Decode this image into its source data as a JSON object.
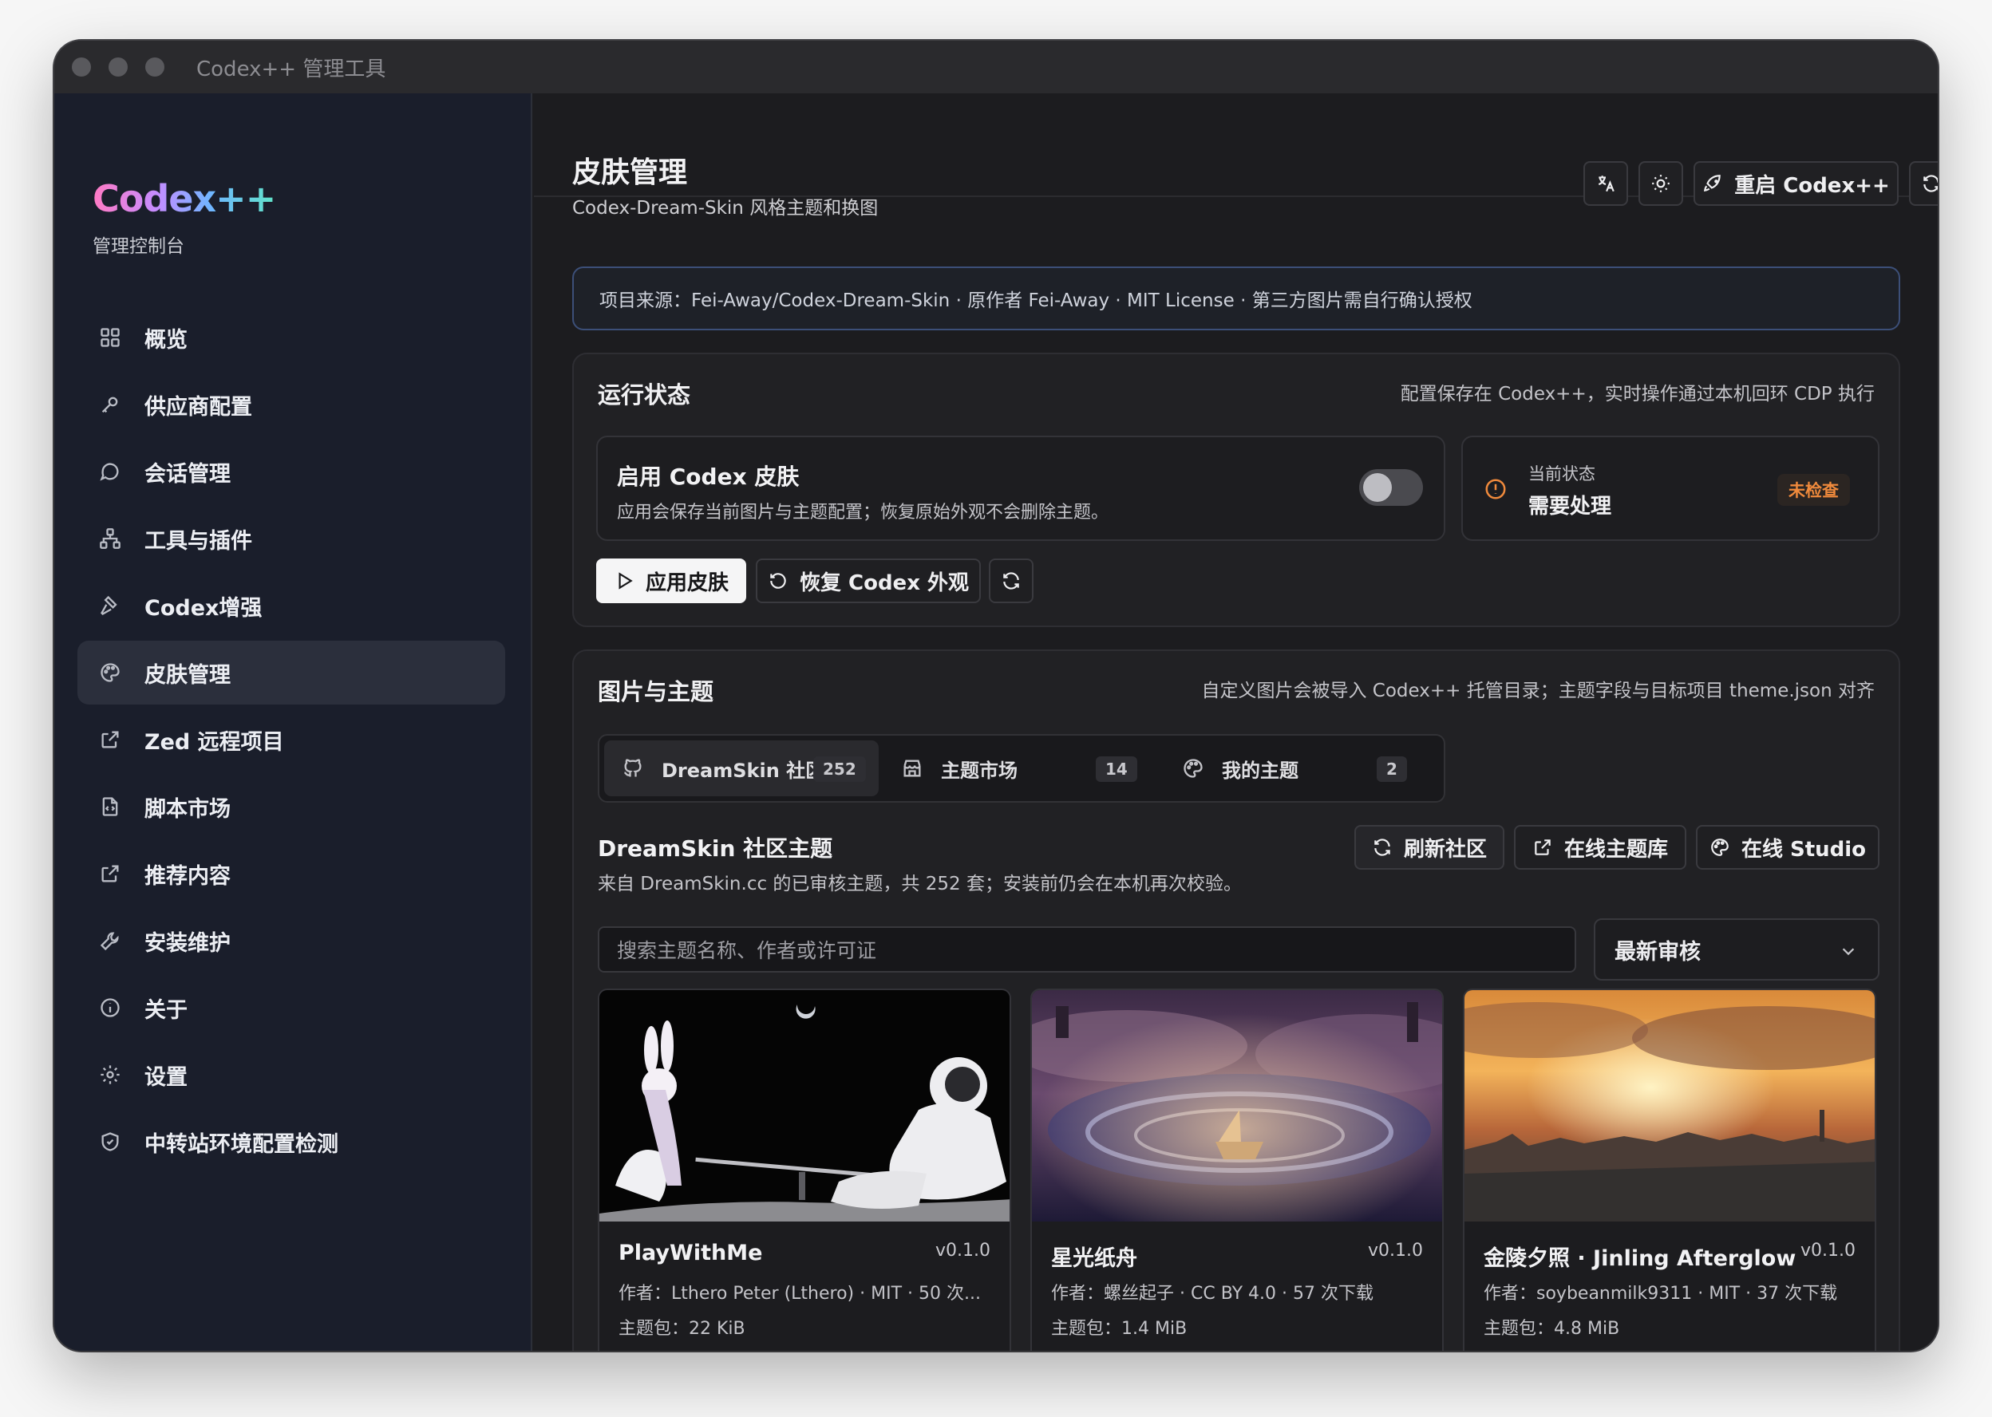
{
  "window": {
    "title": "Codex++ 管理工具"
  },
  "sidebar": {
    "brand": "Codex++",
    "subtitle": "管理控制台",
    "items": [
      {
        "label": "概览",
        "icon": "grid-icon",
        "active": false
      },
      {
        "label": "供应商配置",
        "icon": "key-icon",
        "active": false
      },
      {
        "label": "会话管理",
        "icon": "chat-bubble-icon",
        "active": false
      },
      {
        "label": "工具与插件",
        "icon": "network-icon",
        "active": false
      },
      {
        "label": "Codex增强",
        "icon": "hammer-icon",
        "active": false
      },
      {
        "label": "皮肤管理",
        "icon": "palette-icon",
        "active": true
      },
      {
        "label": "Zed 远程项目",
        "icon": "external-link-icon",
        "active": false
      },
      {
        "label": "脚本市场",
        "icon": "script-file-icon",
        "active": false
      },
      {
        "label": "推荐内容",
        "icon": "external-link-icon",
        "active": false
      },
      {
        "label": "安装维护",
        "icon": "wrench-icon",
        "active": false
      },
      {
        "label": "关于",
        "icon": "info-icon",
        "active": false
      },
      {
        "label": "设置",
        "icon": "gear-icon",
        "active": false
      },
      {
        "label": "中转站环境配置检测",
        "icon": "shield-check-icon",
        "active": false
      }
    ]
  },
  "header": {
    "title": "皮肤管理",
    "subtitle": "Codex-Dream-Skin 风格主题和换图",
    "restart_label": "重启 Codex++"
  },
  "notice": "项目来源：Fei-Away/Codex-Dream-Skin · 原作者 Fei-Away · MIT License · 第三方图片需自行确认授权",
  "runtime": {
    "title": "运行状态",
    "note": "配置保存在 Codex++，实时操作通过本机回环 CDP 执行",
    "enable_title": "启用 Codex 皮肤",
    "enable_desc": "应用会保存当前图片与主题配置；恢复原始外观不会删除主题。",
    "toggle_on": false,
    "status_label": "当前状态",
    "status_value": "需要处理",
    "status_badge": "未检查",
    "status_color": "#f08a3c",
    "apply_label": "应用皮肤",
    "restore_label": "恢复 Codex 外观"
  },
  "themes": {
    "title": "图片与主题",
    "note": "自定义图片会被导入 Codex++ 托管目录；主题字段与目标项目 theme.json 对齐",
    "tabs": [
      {
        "label": "DreamSkin 社区",
        "count": "252",
        "icon": "github-icon"
      },
      {
        "label": "主题市场",
        "count": "14",
        "icon": "store-icon"
      },
      {
        "label": "我的主题",
        "count": "2",
        "icon": "palette-icon"
      }
    ],
    "section_title": "DreamSkin 社区主题",
    "section_desc": "来自 DreamSkin.cc 的已审核主题，共 252 套；安装前仍会在本机再次校验。",
    "refresh_label": "刷新社区",
    "online_lib_label": "在线主题库",
    "studio_label": "在线 Studio",
    "search_placeholder": "搜索主题名称、作者或许可证",
    "sort_value": "最新审核",
    "cards": [
      {
        "name": "PlayWithMe",
        "version": "v0.1.0",
        "meta": "作者：Lthero Peter (Lthero) · MIT · 50 次...",
        "package": "主题包：22 KiB"
      },
      {
        "name": "星光纸舟",
        "version": "v0.1.0",
        "meta": "作者：螺丝起子 · CC BY 4.0 · 57 次下载",
        "package": "主题包：1.4 MiB"
      },
      {
        "name": "金陵夕照 · Jinling Afterglow",
        "version": "v0.1.0",
        "meta": "作者：soybeanmilk9311 · MIT · 37 次下载",
        "package": "主题包：4.8 MiB"
      }
    ]
  }
}
